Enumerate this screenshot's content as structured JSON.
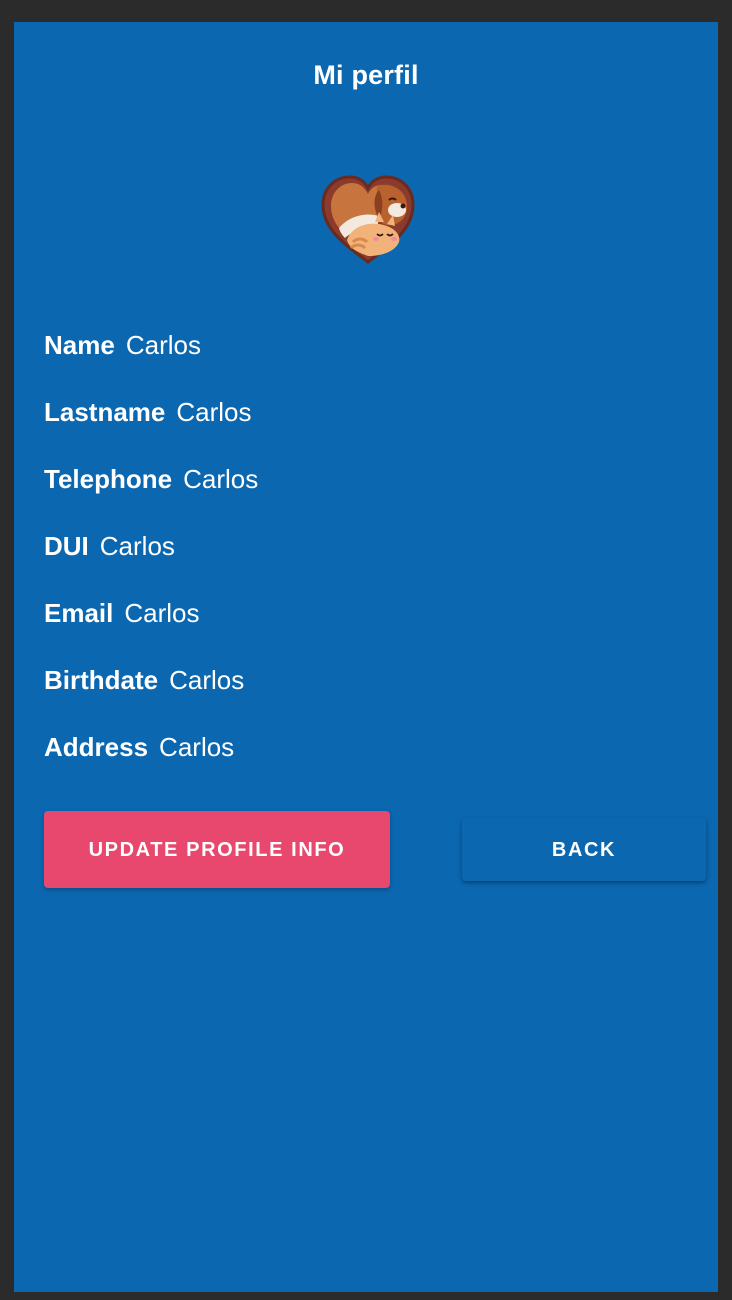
{
  "header": {
    "title": "Mi perfil"
  },
  "logo": {
    "icon": "pet-heart-logo-icon"
  },
  "profile": {
    "fields": [
      {
        "label": "Name",
        "value": "Carlos"
      },
      {
        "label": "Lastname",
        "value": "Carlos"
      },
      {
        "label": "Telephone",
        "value": "Carlos"
      },
      {
        "label": "DUI",
        "value": "Carlos"
      },
      {
        "label": "Email",
        "value": "Carlos"
      },
      {
        "label": "Birthdate",
        "value": "Carlos"
      },
      {
        "label": "Address",
        "value": "Carlos"
      }
    ]
  },
  "actions": {
    "update_label": "UPDATE PROFILE INFO",
    "back_label": "BACK"
  },
  "colors": {
    "background": "#0b67b0",
    "primary_button": "#e8476e",
    "text": "#ffffff",
    "frame": "#2b2b2b"
  }
}
